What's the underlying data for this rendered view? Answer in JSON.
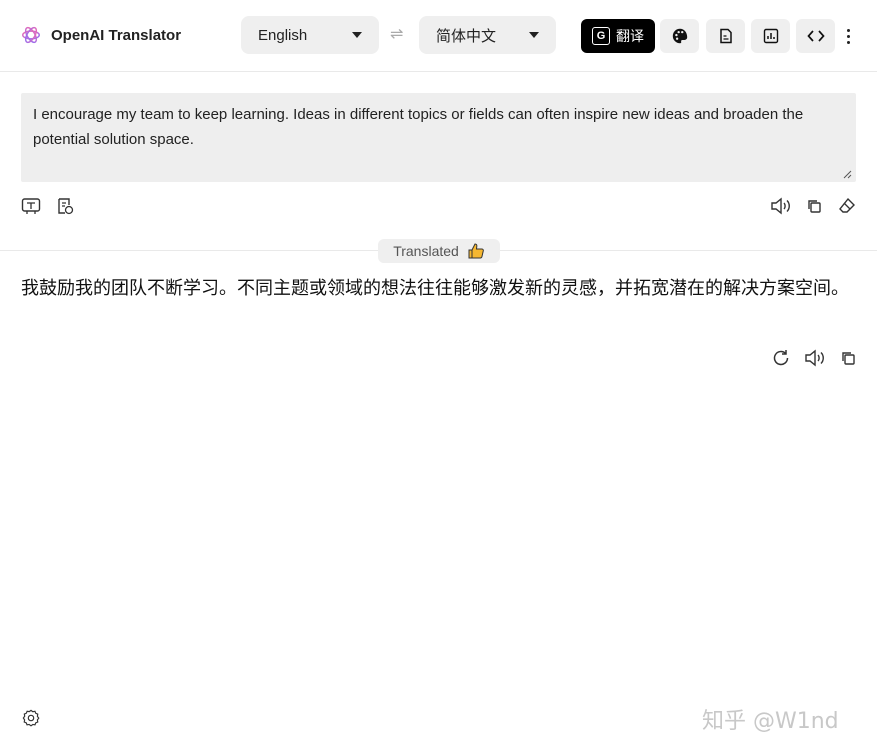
{
  "header": {
    "app_title": "OpenAI Translator",
    "source_language": "English",
    "target_language": "简体中文",
    "swap_icon": "⇌",
    "translate_label": "翻译",
    "translate_icon_text": "G"
  },
  "source": {
    "text": "I encourage my team to keep learning. Ideas in different topics or fields can often inspire new ideas and broaden the potential solution space."
  },
  "result": {
    "badge_label": "Translated",
    "text": "我鼓励我的团队不断学习。不同主题或领域的想法往往能够激发新的灵感，并拓宽潜在的解决方案空间。"
  },
  "watermark": "知乎 @W1nd",
  "colors": {
    "accent": "#000000",
    "panel": "#eeeeee",
    "button_bg": "#efefef"
  }
}
